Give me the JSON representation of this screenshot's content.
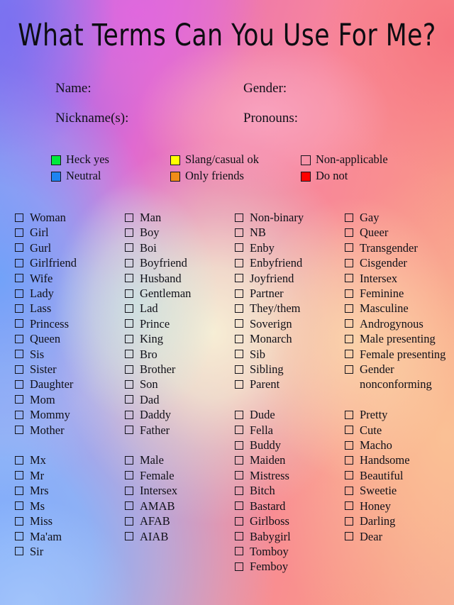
{
  "title": "What Terms Can You Use For Me?",
  "header_fields": [
    {
      "id": "name",
      "label": "Name:"
    },
    {
      "id": "gender",
      "label": "Gender:"
    },
    {
      "id": "nickname",
      "label": "Nickname(s):"
    },
    {
      "id": "pronouns",
      "label": "Pronouns:"
    }
  ],
  "legend": {
    "rows": [
      [
        {
          "label": "Heck yes",
          "color": "#00e83c"
        },
        {
          "label": "Slang/casual ok",
          "color": "#ffff00"
        },
        {
          "label": "Non-applicable",
          "color": "transparent"
        }
      ],
      [
        {
          "label": "Neutral",
          "color": "#1e84f0"
        },
        {
          "label": "Only friends",
          "color": "#f08c18"
        },
        {
          "label": "Do not",
          "color": "#ff0000"
        }
      ]
    ]
  },
  "columns": [
    {
      "id": "column-1",
      "groups": [
        {
          "id": "feminine-terms",
          "items": [
            "Woman",
            "Girl",
            "Gurl",
            "Girlfriend",
            "Wife",
            "Lady",
            "Lass",
            "Princess",
            "Queen",
            "Sis",
            "Sister",
            "Daughter",
            "Mom",
            "Mommy",
            "Mother"
          ]
        },
        {
          "id": "feminine-honorifics",
          "items": [
            "Mx",
            "Mr",
            "Mrs",
            "Ms",
            "Miss",
            "Ma'am",
            "Sir"
          ]
        }
      ]
    },
    {
      "id": "column-2",
      "groups": [
        {
          "id": "masculine-terms",
          "items": [
            "Man",
            "Boy",
            "Boi",
            "Boyfriend",
            "Husband",
            "Gentleman",
            "Lad",
            "Prince",
            "King",
            "Bro",
            "Brother",
            "Son",
            "Dad",
            "Daddy",
            "Father"
          ]
        },
        {
          "id": "sex-assigned-terms",
          "items": [
            "Male",
            "Female",
            "Intersex",
            "AMAB",
            "AFAB",
            "AIAB"
          ]
        }
      ]
    },
    {
      "id": "column-3",
      "groups": [
        {
          "id": "nonbinary-terms",
          "items": [
            "Non-binary",
            "NB",
            "Enby",
            "Enbyfriend",
            "Joyfriend",
            "Partner",
            "They/them",
            "Soverign",
            "Monarch",
            "Sib",
            "Sibling",
            "Parent"
          ]
        },
        {
          "id": "casual-terms",
          "items": [
            "Dude",
            "Fella",
            "Buddy",
            "Maiden",
            "Mistress",
            "Bitch",
            "Bastard",
            "Girlboss",
            "Babygirl",
            "Tomboy",
            "Femboy"
          ]
        }
      ]
    },
    {
      "id": "column-4",
      "groups": [
        {
          "id": "identity-terms",
          "items": [
            "Gay",
            "Queer",
            "Transgender",
            "Cisgender",
            "Intersex",
            "Feminine",
            "Masculine",
            "Androgynous",
            "Male presenting",
            "Female presenting",
            "Gender nonconforming"
          ]
        },
        {
          "id": "endearment-terms",
          "items": [
            "Pretty",
            "Cute",
            "Macho",
            "Handsome",
            "Beautiful",
            "Sweetie",
            "Honey",
            "Darling",
            "Dear"
          ]
        }
      ]
    }
  ]
}
